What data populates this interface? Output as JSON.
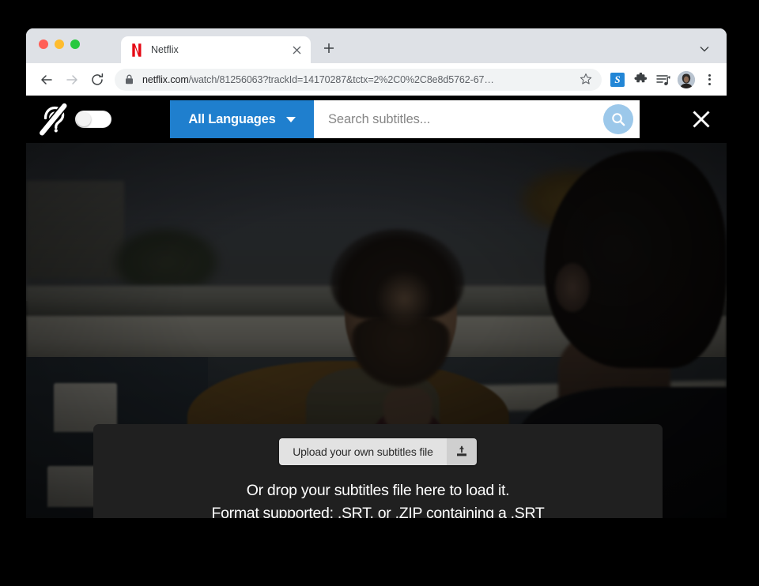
{
  "browser": {
    "traffic_lights": [
      "close-red",
      "minimize-amber",
      "maximize-green"
    ],
    "tab": {
      "favicon": "netflix-n-logo",
      "title": "Netflix",
      "close_label": "✕"
    },
    "new_tab_label": "+",
    "tabstrip_chevron": "chevron-down-icon",
    "nav": {
      "back": "back-arrow-icon",
      "forward": "forward-arrow-icon",
      "reload": "reload-icon"
    },
    "omnibox": {
      "lock": "lock-icon",
      "host": "netflix.com",
      "path": "/watch/81256063?trackId=14170287&tctx=2%2C0%2C8e8d5762-67…",
      "full_url": "netflix.com/watch/81256063?trackId=14170287&tctx=2%2C0%2C8e8d5762-67…",
      "bookmark": "star-icon"
    },
    "extensions": [
      {
        "name": "subtitle-extension-icon",
        "glyph": "S"
      },
      {
        "name": "puzzle-extensions-icon"
      },
      {
        "name": "media-playlist-icon"
      },
      {
        "name": "profile-avatar"
      }
    ],
    "menu": "three-dot-menu-icon"
  },
  "subtitle_bar": {
    "deaf_icon": "deaf-hard-of-hearing-icon",
    "toggle": {
      "name": "subtitles-toggle",
      "state": "off"
    },
    "language_button": {
      "label": "All Languages",
      "caret": "chevron-down-icon",
      "color": "#1f7fce"
    },
    "search": {
      "placeholder": "Search subtitles...",
      "value": "",
      "go_icon": "search-icon",
      "go_color": "#9cc8ea"
    },
    "close": "close-icon"
  },
  "drop_panel": {
    "upload_button": {
      "label": "Upload your own subtitles file",
      "icon": "upload-icon"
    },
    "line1": "Or drop your subtitles file here to load it.",
    "line2": "Format supported: .SRT, or .ZIP containing a .SRT"
  },
  "video": {
    "description": "Darkened Netflix video still: bearded man in tan coat and scarf talking outdoors on a rooftop, back of second person's head at right"
  }
}
